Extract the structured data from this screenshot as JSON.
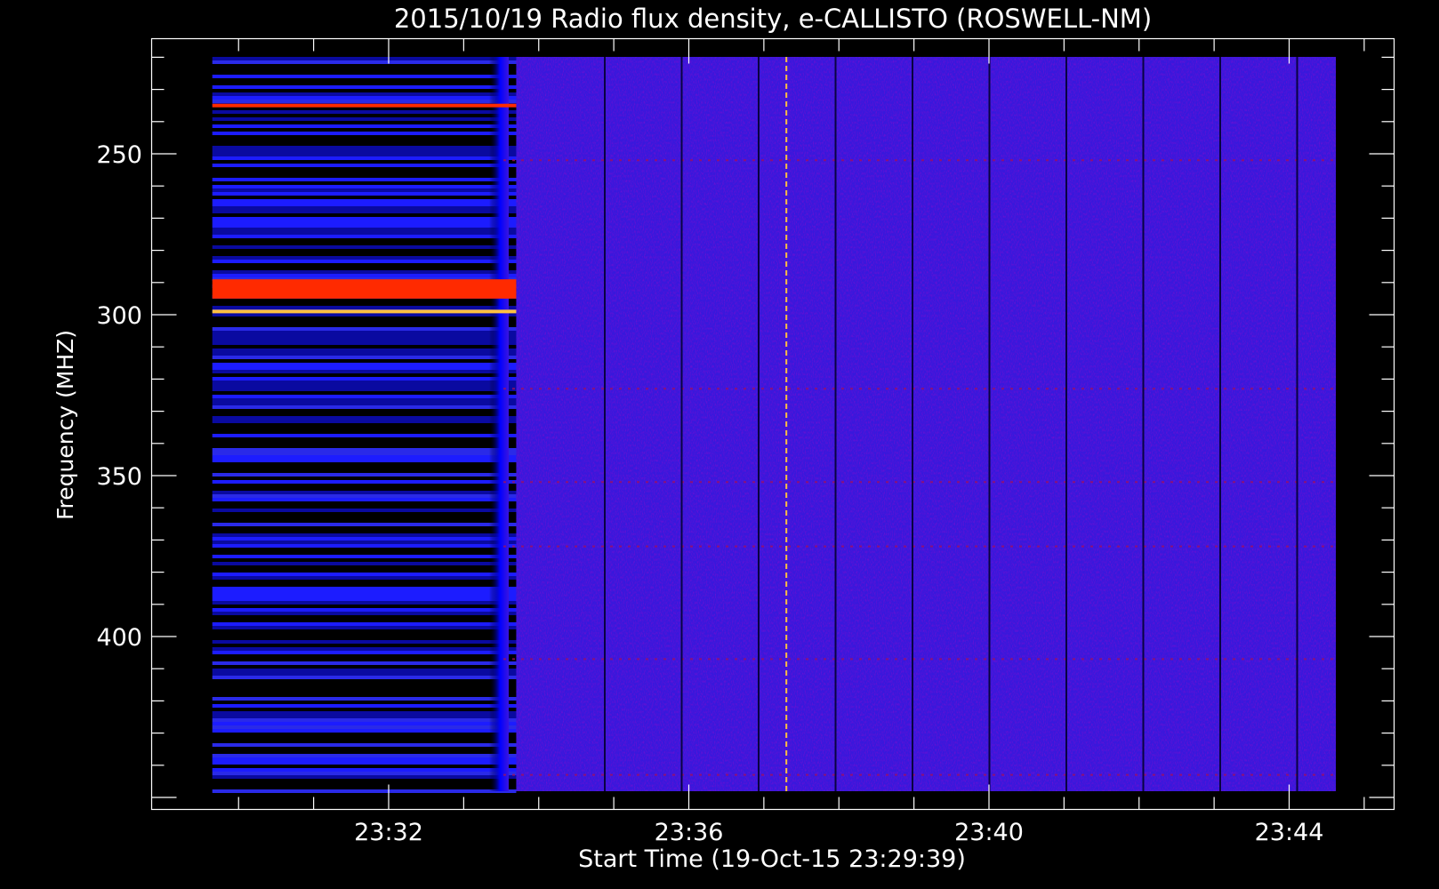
{
  "chart_data": {
    "type": "heatmap",
    "title": "2015/10/19  Radio flux density, e-CALLISTO (ROSWELL-NM)",
    "xlabel": "Start Time (19-Oct-15 23:29:39)",
    "ylabel": "Frequency (MHZ)",
    "x_ticks": [
      "23:32",
      "23:36",
      "23:40",
      "23:44"
    ],
    "y_ticks": [
      250,
      300,
      350,
      400
    ],
    "y_axis_inverted": true,
    "colormap": [
      "#000000",
      "#1a10f0",
      "#5a1ecc",
      "#ff2000",
      "#ffb400"
    ],
    "colors": {
      "background": "#000000",
      "frame": "#ffffff",
      "quiet_background": "#2414e6",
      "burst_red": "#ff2a00",
      "burst_yellow": "#ffc040"
    },
    "features": [
      {
        "name": "intense band",
        "freq_range_mhz": [
          289,
          295
        ],
        "time_range": [
          "23:29:39",
          "23:33:42"
        ]
      },
      {
        "name": "intense line",
        "freq_mhz": 299,
        "time_range": [
          "23:29:39",
          "23:33:42"
        ]
      },
      {
        "name": "red line",
        "freq_mhz": 235,
        "time_range": [
          "23:29:39",
          "23:33:42"
        ]
      },
      {
        "name": "vertical spike",
        "time": "23:37:18"
      }
    ]
  }
}
